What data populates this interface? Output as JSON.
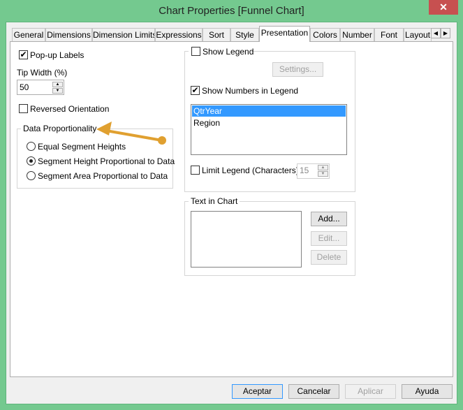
{
  "window": {
    "title": "Chart Properties [Funnel Chart]",
    "close_icon": "close-icon"
  },
  "tabs": [
    "General",
    "Dimensions",
    "Dimension Limits",
    "Expressions",
    "Sort",
    "Style",
    "Presentation",
    "Colors",
    "Number",
    "Font",
    "Layout"
  ],
  "active_tab": "Presentation",
  "left": {
    "popup_labels": {
      "label": "Pop-up Labels",
      "checked": true
    },
    "tip_width": {
      "label": "Tip Width (%)",
      "value": "50"
    },
    "reversed": {
      "label": "Reversed Orientation",
      "checked": false
    },
    "proportionality": {
      "title": "Data Proportionality",
      "options": [
        "Equal Segment Heights",
        "Segment Height Proportional to Data",
        "Segment Area Proportional to Data"
      ],
      "selected": "Segment Height Proportional to Data"
    }
  },
  "legend": {
    "show_legend": {
      "label": "Show Legend",
      "checked": false
    },
    "settings_label": "Settings...",
    "show_numbers": {
      "label": "Show Numbers in Legend",
      "checked": true
    },
    "items": [
      "QtrYear",
      "Region"
    ],
    "selected": "QtrYear",
    "limit": {
      "label": "Limit Legend (Characters)",
      "checked": false,
      "value": "15"
    }
  },
  "text_in_chart": {
    "title": "Text in Chart",
    "add": "Add...",
    "edit": "Edit...",
    "delete": "Delete"
  },
  "footer": {
    "ok": "Aceptar",
    "cancel": "Cancelar",
    "apply": "Aplicar",
    "help": "Ayuda"
  },
  "colors": {
    "frame": "#74c98f",
    "close": "#c75050",
    "selection": "#3399ff",
    "annotation": "#e0a030"
  }
}
